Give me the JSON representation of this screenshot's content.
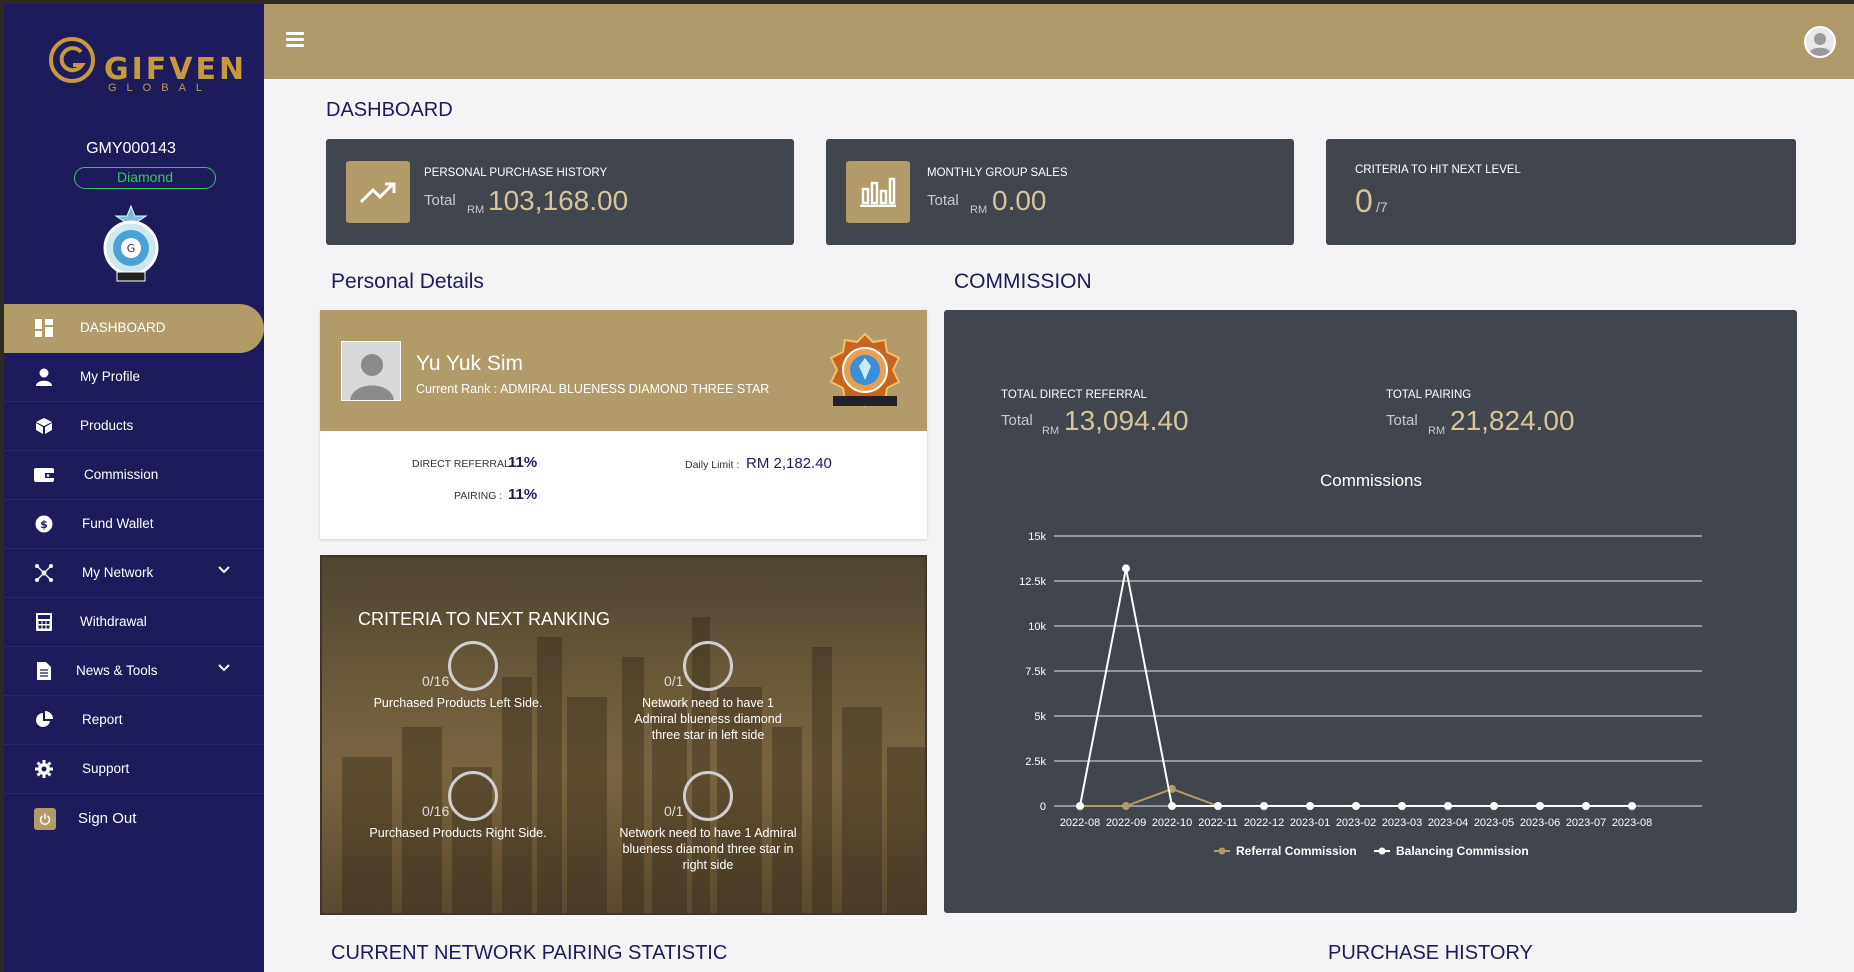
{
  "sidebar": {
    "logo_text": "GIFVEN",
    "logo_sub": "GLOBAL",
    "user_id": "GMY000143",
    "rank": "Diamond",
    "items": [
      {
        "label": "DASHBOARD",
        "icon": "dashboard-icon",
        "active": true
      },
      {
        "label": "My Profile",
        "icon": "user-icon"
      },
      {
        "label": "Products",
        "icon": "box-icon"
      },
      {
        "label": "Commission",
        "icon": "wallet-icon"
      },
      {
        "label": "Fund Wallet",
        "icon": "dollar-icon"
      },
      {
        "label": "My Network",
        "icon": "network-icon",
        "chevron": true
      },
      {
        "label": "Withdrawal",
        "icon": "calculator-icon"
      },
      {
        "label": "News & Tools",
        "icon": "document-icon",
        "chevron": true
      },
      {
        "label": "Report",
        "icon": "pie-chart-icon"
      },
      {
        "label": "Support",
        "icon": "gear-icon"
      },
      {
        "label": "Sign Out",
        "icon": "power-icon"
      }
    ]
  },
  "page_title": "DASHBOARD",
  "stats": [
    {
      "label": "PERSONAL PURCHASE HISTORY",
      "total": "Total",
      "currency": "RM",
      "value": "103,168.00",
      "icon": "trend-up-icon"
    },
    {
      "label": "MONTHLY GROUP SALES",
      "total": "Total",
      "currency": "RM",
      "value": "0.00",
      "icon": "bar-chart-icon"
    },
    {
      "label": "CRITERIA TO HIT NEXT LEVEL",
      "value": "0",
      "suffix": "/7"
    }
  ],
  "personal": {
    "section_title": "Personal Details",
    "name": "Yu Yuk Sim",
    "rank_line": "Current Rank : ADMIRAL BLUENESS DIAMOND THREE STAR",
    "direct_referral_label": "DIRECT REFERRAL :",
    "direct_referral_value": "11%",
    "pairing_label": "PAIRING :",
    "pairing_value": "11%",
    "daily_limit_label": "Daily Limit :",
    "daily_limit_value": "RM 2,182.40"
  },
  "criteria": {
    "title": "CRITERIA TO NEXT RANKING",
    "items": [
      {
        "count": "0/16",
        "text": "Purchased Products Left Side."
      },
      {
        "count": "0/1",
        "text": "Network need to have 1 Admiral blueness diamond three star in left side"
      },
      {
        "count": "0/16",
        "text": "Purchased Products Right Side."
      },
      {
        "count": "0/1",
        "text": "Network need to have 1 Admiral blueness diamond three star in right side"
      }
    ]
  },
  "commission": {
    "section_title": "COMMISSION",
    "direct_label": "TOTAL DIRECT REFERRAL",
    "direct_total": "Total",
    "direct_rm": "RM",
    "direct_value": "13,094.40",
    "pairing_label": "TOTAL PAIRING",
    "pairing_total": "Total",
    "pairing_rm": "RM",
    "pairing_value": "21,824.00"
  },
  "chart_data": {
    "type": "line",
    "title": "Commissions",
    "categories": [
      "2022-08",
      "2022-09",
      "2022-10",
      "2022-11",
      "2022-12",
      "2023-01",
      "2023-02",
      "2023-03",
      "2023-04",
      "2023-05",
      "2023-06",
      "2023-07",
      "2023-08"
    ],
    "series": [
      {
        "name": "Referral Commission",
        "color": "#b19b69",
        "values": [
          0,
          0,
          950,
          0,
          0,
          0,
          0,
          0,
          0,
          0,
          0,
          0,
          0
        ]
      },
      {
        "name": "Balancing Commission",
        "color": "#ffffff",
        "values": [
          0,
          13200,
          0,
          0,
          0,
          0,
          0,
          0,
          0,
          0,
          0,
          0,
          0
        ]
      }
    ],
    "yticks": [
      "0",
      "2.5k",
      "5k",
      "7.5k",
      "10k",
      "12.5k",
      "15k"
    ],
    "ylim": [
      0,
      15000
    ],
    "grid": true,
    "legend": "bottom"
  },
  "bottom": {
    "network_title": "CURRENT NETWORK PAIRING STATISTIC",
    "purchase_title": "PURCHASE HISTORY"
  },
  "colors": {
    "sidebar": "#1d1b5b",
    "gold": "#b19b69",
    "card": "#41454d",
    "value_gold": "#d8c49a"
  }
}
